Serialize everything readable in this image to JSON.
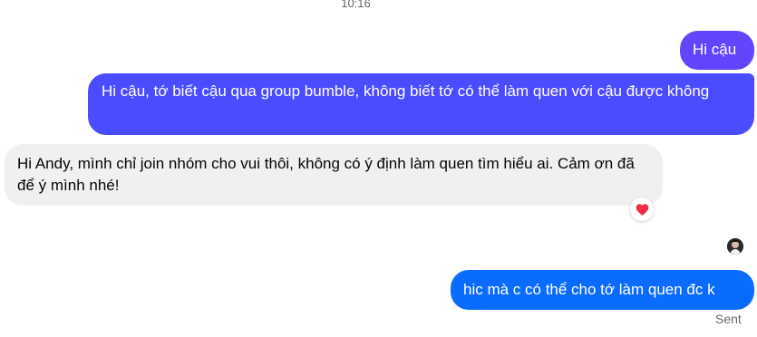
{
  "conversation": {
    "timestamp": "10:16",
    "messages": [
      {
        "direction": "outgoing",
        "text": "Hi cậu"
      },
      {
        "direction": "outgoing",
        "text": "Hi cậu, tớ biết cậu qua group bumble, không biết tớ có thể làm quen với cậu được không"
      },
      {
        "direction": "incoming",
        "text": "Hi Andy, mình chỉ join nhóm cho vui thôi, không có ý định làm quen tìm hiểu ai. Cảm ơn đã để ý mình nhé!",
        "reaction": "heart-icon"
      },
      {
        "direction": "outgoing",
        "text": "hic mà c có thể cho tớ làm quen đc k"
      }
    ],
    "status": "Sent"
  },
  "colors": {
    "outgoing_top": "#6344ff",
    "outgoing_middle": "#4b4cff",
    "outgoing_bottom": "#0a6cff",
    "incoming": "#f0f0f0",
    "reaction_heart": "#ef2d4a"
  },
  "icons": {
    "reaction": "heart-icon",
    "seen": "avatar-icon"
  }
}
